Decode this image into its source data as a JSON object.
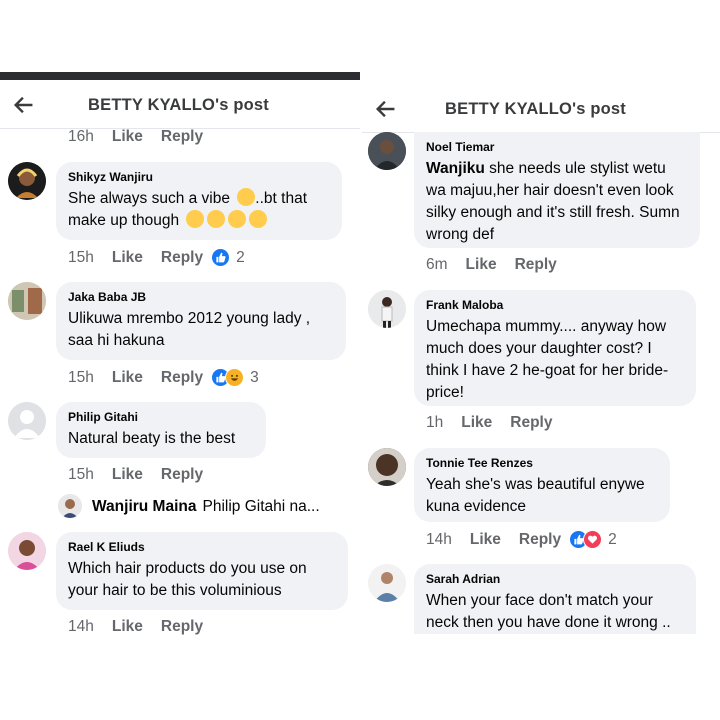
{
  "header_title": "BETTY KYALLO's post",
  "actions": {
    "like": "Like",
    "reply": "Reply"
  },
  "left": {
    "top_row": {
      "time": "16h"
    },
    "comments": [
      {
        "name": "Shikyz Wanjiru",
        "text_a": "She always such a vibe ",
        "text_b": "..bt that make up  though ",
        "time": "15h",
        "reactions": "2"
      },
      {
        "name": "Jaka Baba JB",
        "text": "Ulikuwa mrembo 2012 young lady , saa hi hakuna",
        "time": "15h",
        "reactions": "3"
      },
      {
        "name": "Philip Gitahi",
        "text": "Natural beaty is the best",
        "time": "15h"
      },
      {
        "name": "Rael K Eliuds",
        "text": "Which hair products  do you use on your hair to be this voluminious",
        "time": "14h"
      }
    ],
    "reply_preview": {
      "name": "Wanjiru Maina",
      "text": "Philip Gitahi na..."
    }
  },
  "right": {
    "comments": [
      {
        "name": "Noel Tiemar",
        "mention": "Wanjiku",
        "text": " she needs ule stylist wetu wa majuu,her hair doesn't even look silky enough and it's still fresh. Sumn wrong def",
        "time": "6m"
      },
      {
        "name": "Frank Maloba",
        "text": "Umechapa mummy.... anyway how much does your daughter cost? I think I have 2 he-goat for her bride-price!",
        "time": "1h"
      },
      {
        "name": "Tonnie Tee Renzes",
        "text": "Yeah she's was beautiful enywe kuna evidence",
        "time": "14h",
        "reactions": "2"
      },
      {
        "name": "Sarah Adrian",
        "text": "When your face don't match your neck then you have done it wrong .."
      }
    ]
  },
  "colors": {
    "like_blue": "#1877f2",
    "haha_yellow": "#f7b125",
    "love_red": "#f33e58",
    "bubble": "#f0f2f5"
  }
}
